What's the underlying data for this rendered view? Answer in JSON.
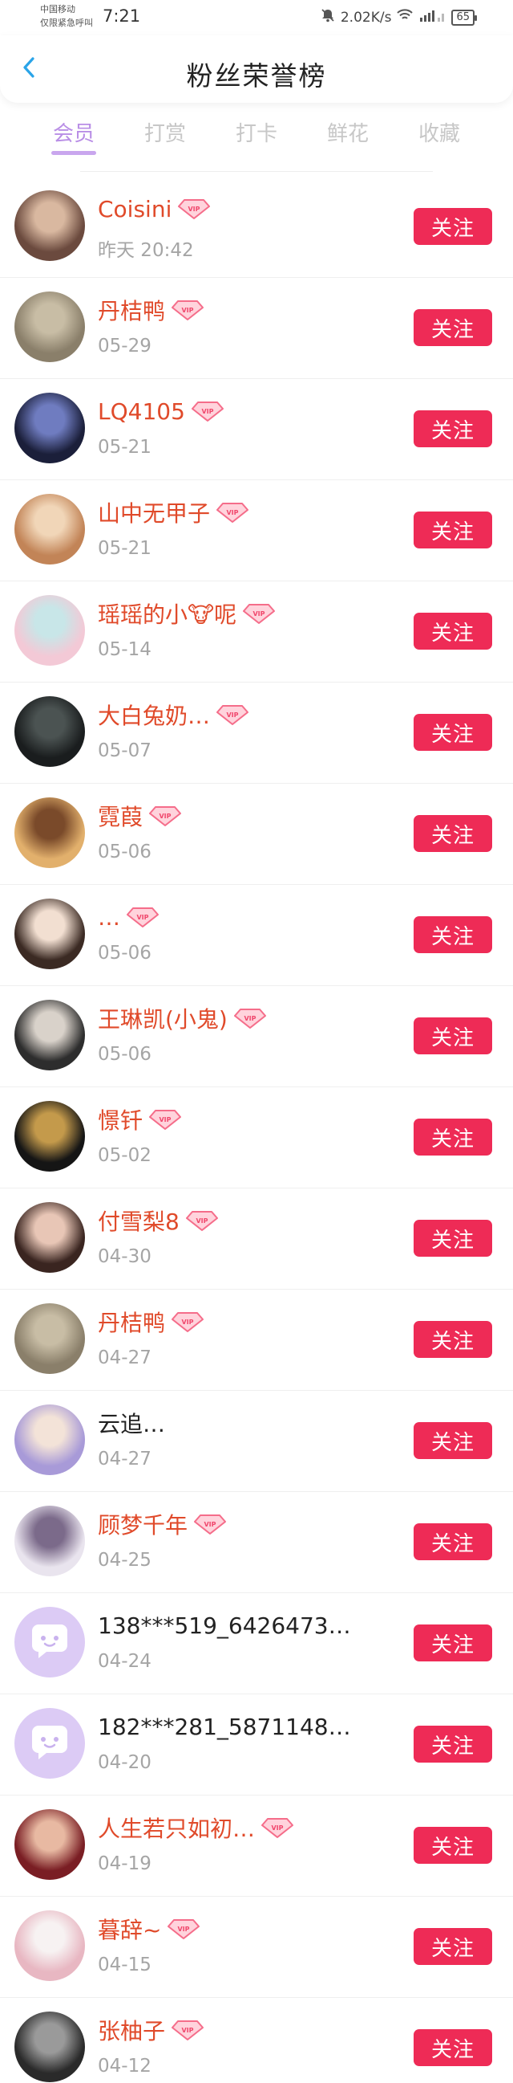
{
  "status_bar": {
    "carrier_line1": "中国移动",
    "carrier_line2": "仅限紧急呼叫",
    "time": "7:21",
    "net_speed": "2.02K/s",
    "signal_label": "⁴ᴳ",
    "battery": "65"
  },
  "header": {
    "title": "粉丝荣誉榜",
    "back_icon": "chevron-left-icon"
  },
  "tabs": [
    {
      "label": "会员",
      "active": true
    },
    {
      "label": "打赏",
      "active": false
    },
    {
      "label": "打卡",
      "active": false
    },
    {
      "label": "鲜花",
      "active": false
    },
    {
      "label": "收藏",
      "active": false
    }
  ],
  "colors": {
    "accent_purple": "#b98ee6",
    "vip_name_red": "#e04a2a",
    "follow_button": "#ee2b56",
    "date_gray": "#a5a5a5"
  },
  "follow_label": "关注",
  "fans": [
    {
      "name": "Coisini",
      "date": "昨天 20:42",
      "vip": true,
      "avatar": "anime-girl",
      "avatar_colors": [
        "#6b4a3e",
        "#d9b8a0"
      ]
    },
    {
      "name": "丹桔鸭",
      "date": "05-29",
      "vip": true,
      "avatar": "field-photo",
      "avatar_colors": [
        "#8a7f6a",
        "#c8bda5"
      ]
    },
    {
      "name": "LQ4105",
      "date": "05-21",
      "vip": true,
      "avatar": "dark-anime",
      "avatar_colors": [
        "#1b1f3a",
        "#6f7cc0"
      ]
    },
    {
      "name": "山中无甲子",
      "date": "05-21",
      "vip": true,
      "avatar": "puppy",
      "avatar_colors": [
        "#c28457",
        "#f1d6b8"
      ]
    },
    {
      "name": "瑶瑶的小🐮呢",
      "date": "05-14",
      "vip": true,
      "avatar": "pastel-girl",
      "avatar_colors": [
        "#f3c9d6",
        "#c8e6e8"
      ]
    },
    {
      "name": "大白兔奶…",
      "date": "05-07",
      "vip": true,
      "avatar": "dark-photo",
      "avatar_colors": [
        "#1a1d1e",
        "#4b5352"
      ]
    },
    {
      "name": "霓葭",
      "date": "05-06",
      "vip": true,
      "avatar": "blonde-girl",
      "avatar_colors": [
        "#e2b06c",
        "#7a4a2a"
      ]
    },
    {
      "name": "…",
      "date": "05-06",
      "vip": true,
      "avatar": "cartoon-girl",
      "avatar_colors": [
        "#3b2a23",
        "#f2dfd1"
      ]
    },
    {
      "name": "王琳凯(小鬼)",
      "date": "05-06",
      "vip": true,
      "avatar": "man-photo",
      "avatar_colors": [
        "#2d2d2d",
        "#d9d2ca"
      ]
    },
    {
      "name": "憬钎",
      "date": "05-02",
      "vip": true,
      "avatar": "stage-photo",
      "avatar_colors": [
        "#151515",
        "#c49a4b"
      ]
    },
    {
      "name": "付雪梨8",
      "date": "04-30",
      "vip": true,
      "avatar": "woman-photo",
      "avatar_colors": [
        "#3a2520",
        "#e8c6b6"
      ]
    },
    {
      "name": "丹桔鸭",
      "date": "04-27",
      "vip": true,
      "avatar": "field-photo",
      "avatar_colors": [
        "#8a7f6a",
        "#c8bda5"
      ]
    },
    {
      "name": "云追…",
      "date": "04-27",
      "vip": false,
      "avatar": "doll-girl",
      "avatar_colors": [
        "#a89ad8",
        "#f3e3d8"
      ]
    },
    {
      "name": "顾梦千年",
      "date": "04-25",
      "vip": true,
      "avatar": "sketch-girl",
      "avatar_colors": [
        "#e9e4ee",
        "#7b6a8a"
      ]
    },
    {
      "name": "138***519_6426473…",
      "date": "04-24",
      "vip": false,
      "avatar": "default-chat",
      "avatar_colors": [
        "#d9c7f3",
        "#ffffff"
      ]
    },
    {
      "name": "182***281_5871148…",
      "date": "04-20",
      "vip": false,
      "avatar": "default-chat",
      "avatar_colors": [
        "#d9c7f3",
        "#ffffff"
      ]
    },
    {
      "name": "人生若只如初…",
      "date": "04-19",
      "vip": true,
      "avatar": "red-anime",
      "avatar_colors": [
        "#7a1e24",
        "#e8b9a2"
      ]
    },
    {
      "name": "暮辞~",
      "date": "04-15",
      "vip": true,
      "avatar": "pink-hair",
      "avatar_colors": [
        "#e8b7c2",
        "#f7f2f2"
      ]
    },
    {
      "name": "张柚子",
      "date": "04-12",
      "vip": true,
      "avatar": "bw-photo",
      "avatar_colors": [
        "#2a2a2a",
        "#9a9a9a"
      ]
    }
  ]
}
